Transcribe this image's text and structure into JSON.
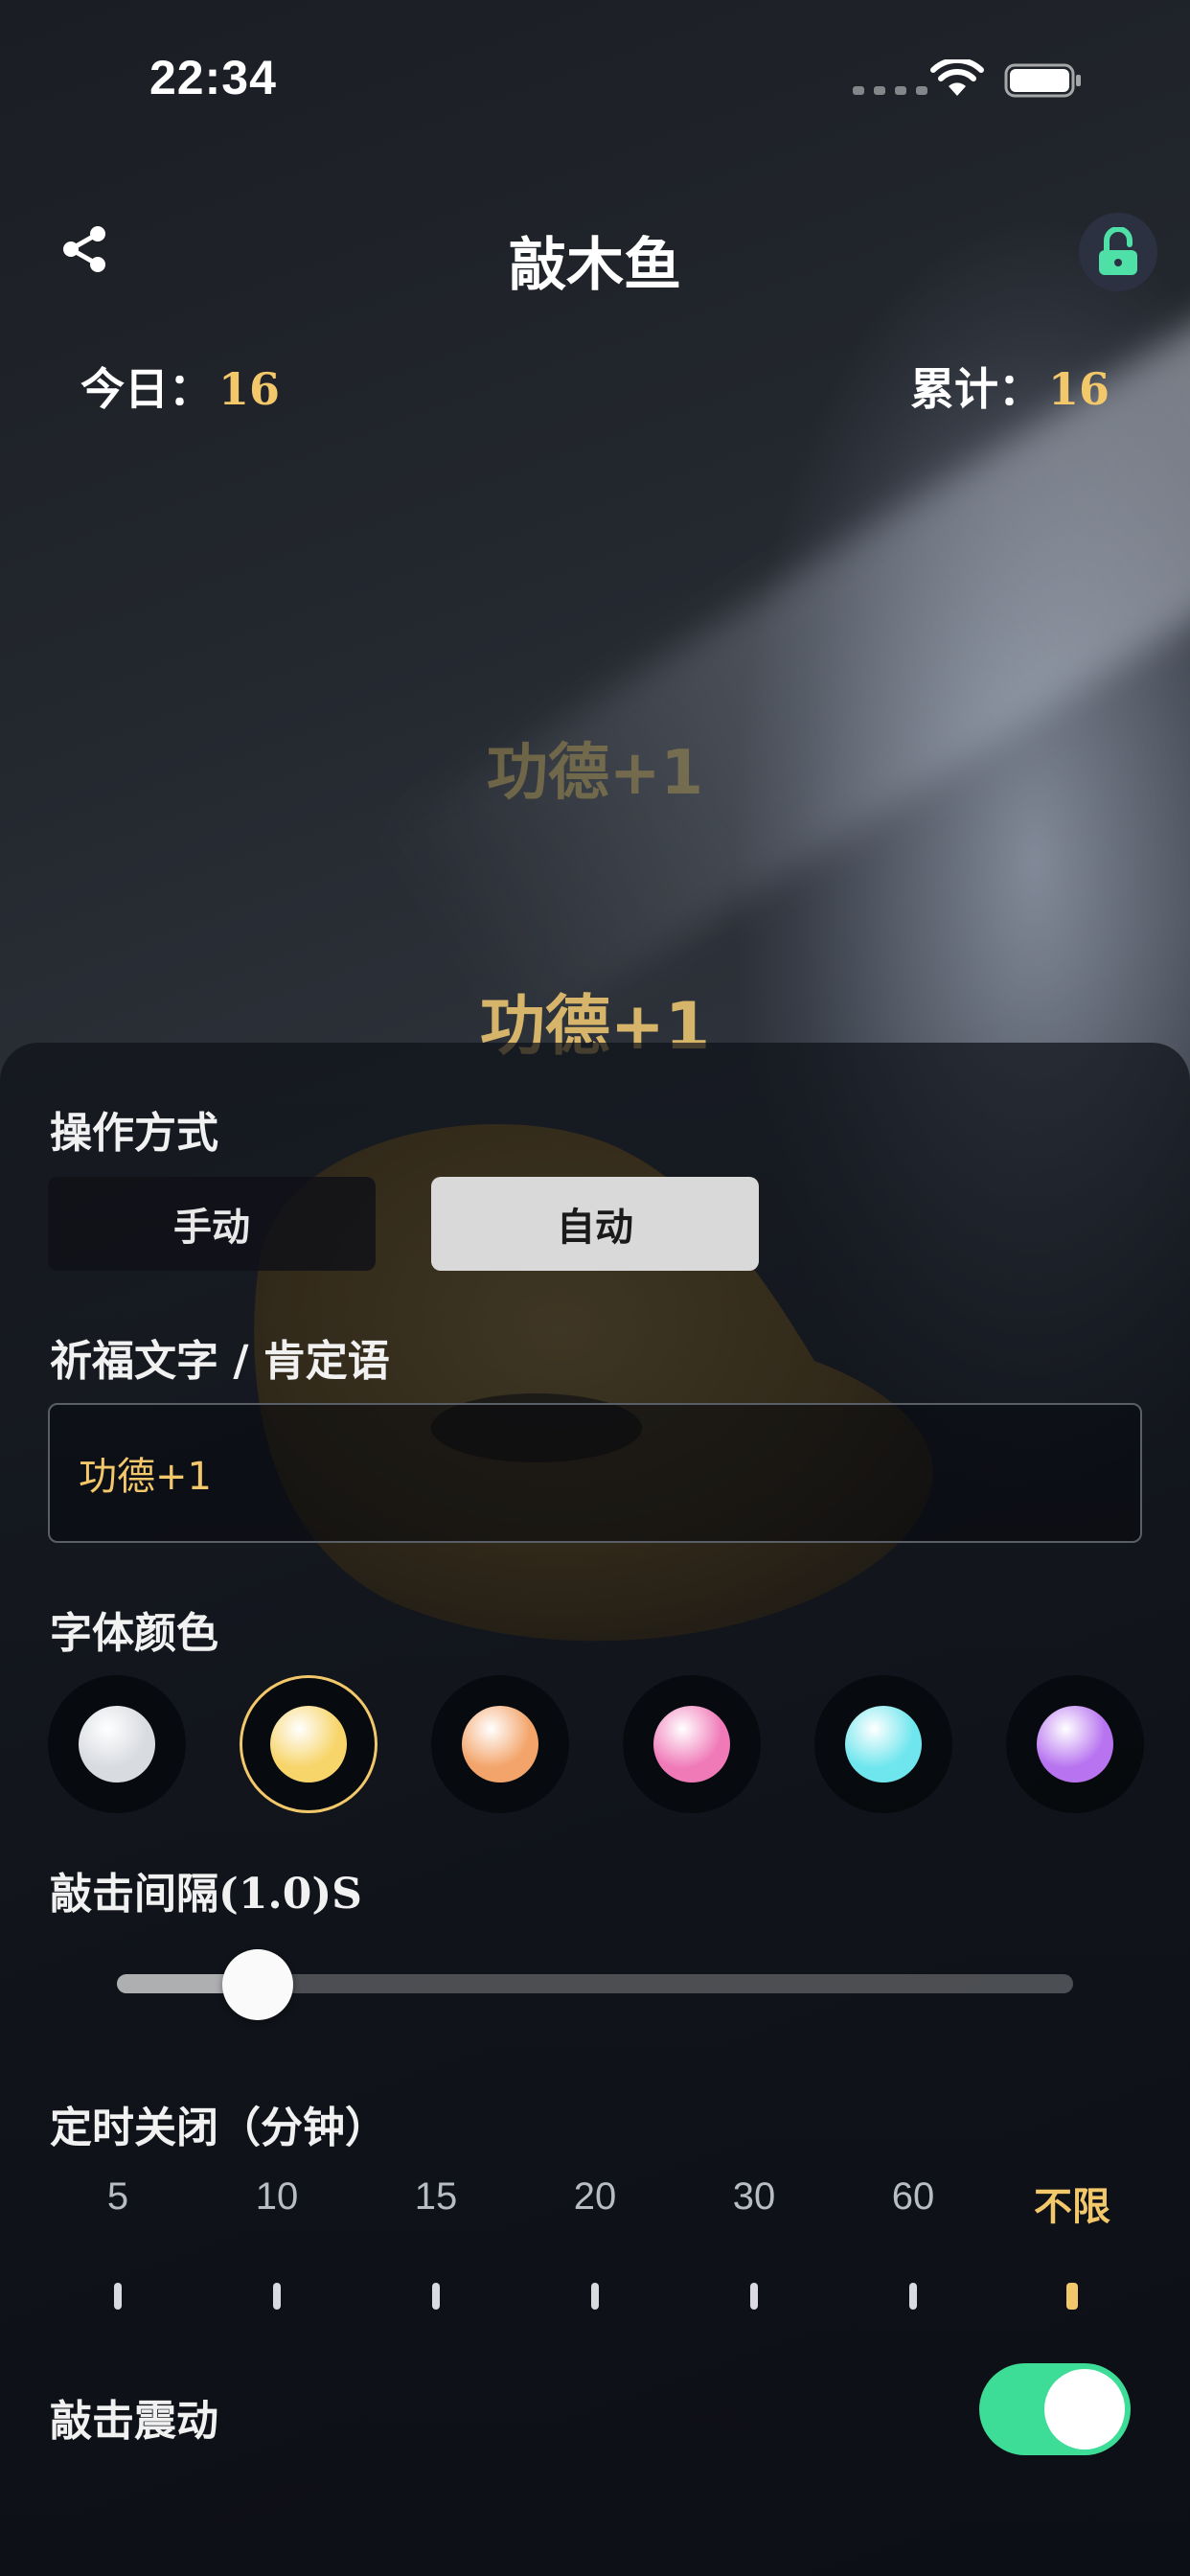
{
  "status_bar": {
    "time": "22:34"
  },
  "header": {
    "title": "敲木鱼"
  },
  "stats": {
    "today_label": "今日：",
    "today_value": "16",
    "total_label": "累计：",
    "total_value": "16"
  },
  "floating": {
    "faded": "功德+1",
    "main": "功德+1"
  },
  "panel": {
    "mode": {
      "label": "操作方式",
      "options": [
        "手动",
        "自动"
      ],
      "selected": "自动"
    },
    "blessing": {
      "label": "祈福文字 / 肯定语",
      "value": "功德+1"
    },
    "font_color": {
      "label": "字体颜色",
      "colors": [
        "#d8dbe0",
        "#f7d56a",
        "#f3a46a",
        "#f07ab8",
        "#6fe6ee",
        "#b773f0"
      ],
      "selected_index": 1
    },
    "interval": {
      "label": "敲击间隔(1.0)S",
      "value_fraction": 0.11
    },
    "timer": {
      "label": "定时关闭（分钟）",
      "options": [
        "5",
        "10",
        "15",
        "20",
        "30",
        "60",
        "不限"
      ],
      "selected": "不限"
    },
    "vibration": {
      "label": "敲击震动",
      "on": true
    }
  },
  "colors": {
    "accent": "#f2c86b",
    "toggle_on": "#3ddc97"
  }
}
